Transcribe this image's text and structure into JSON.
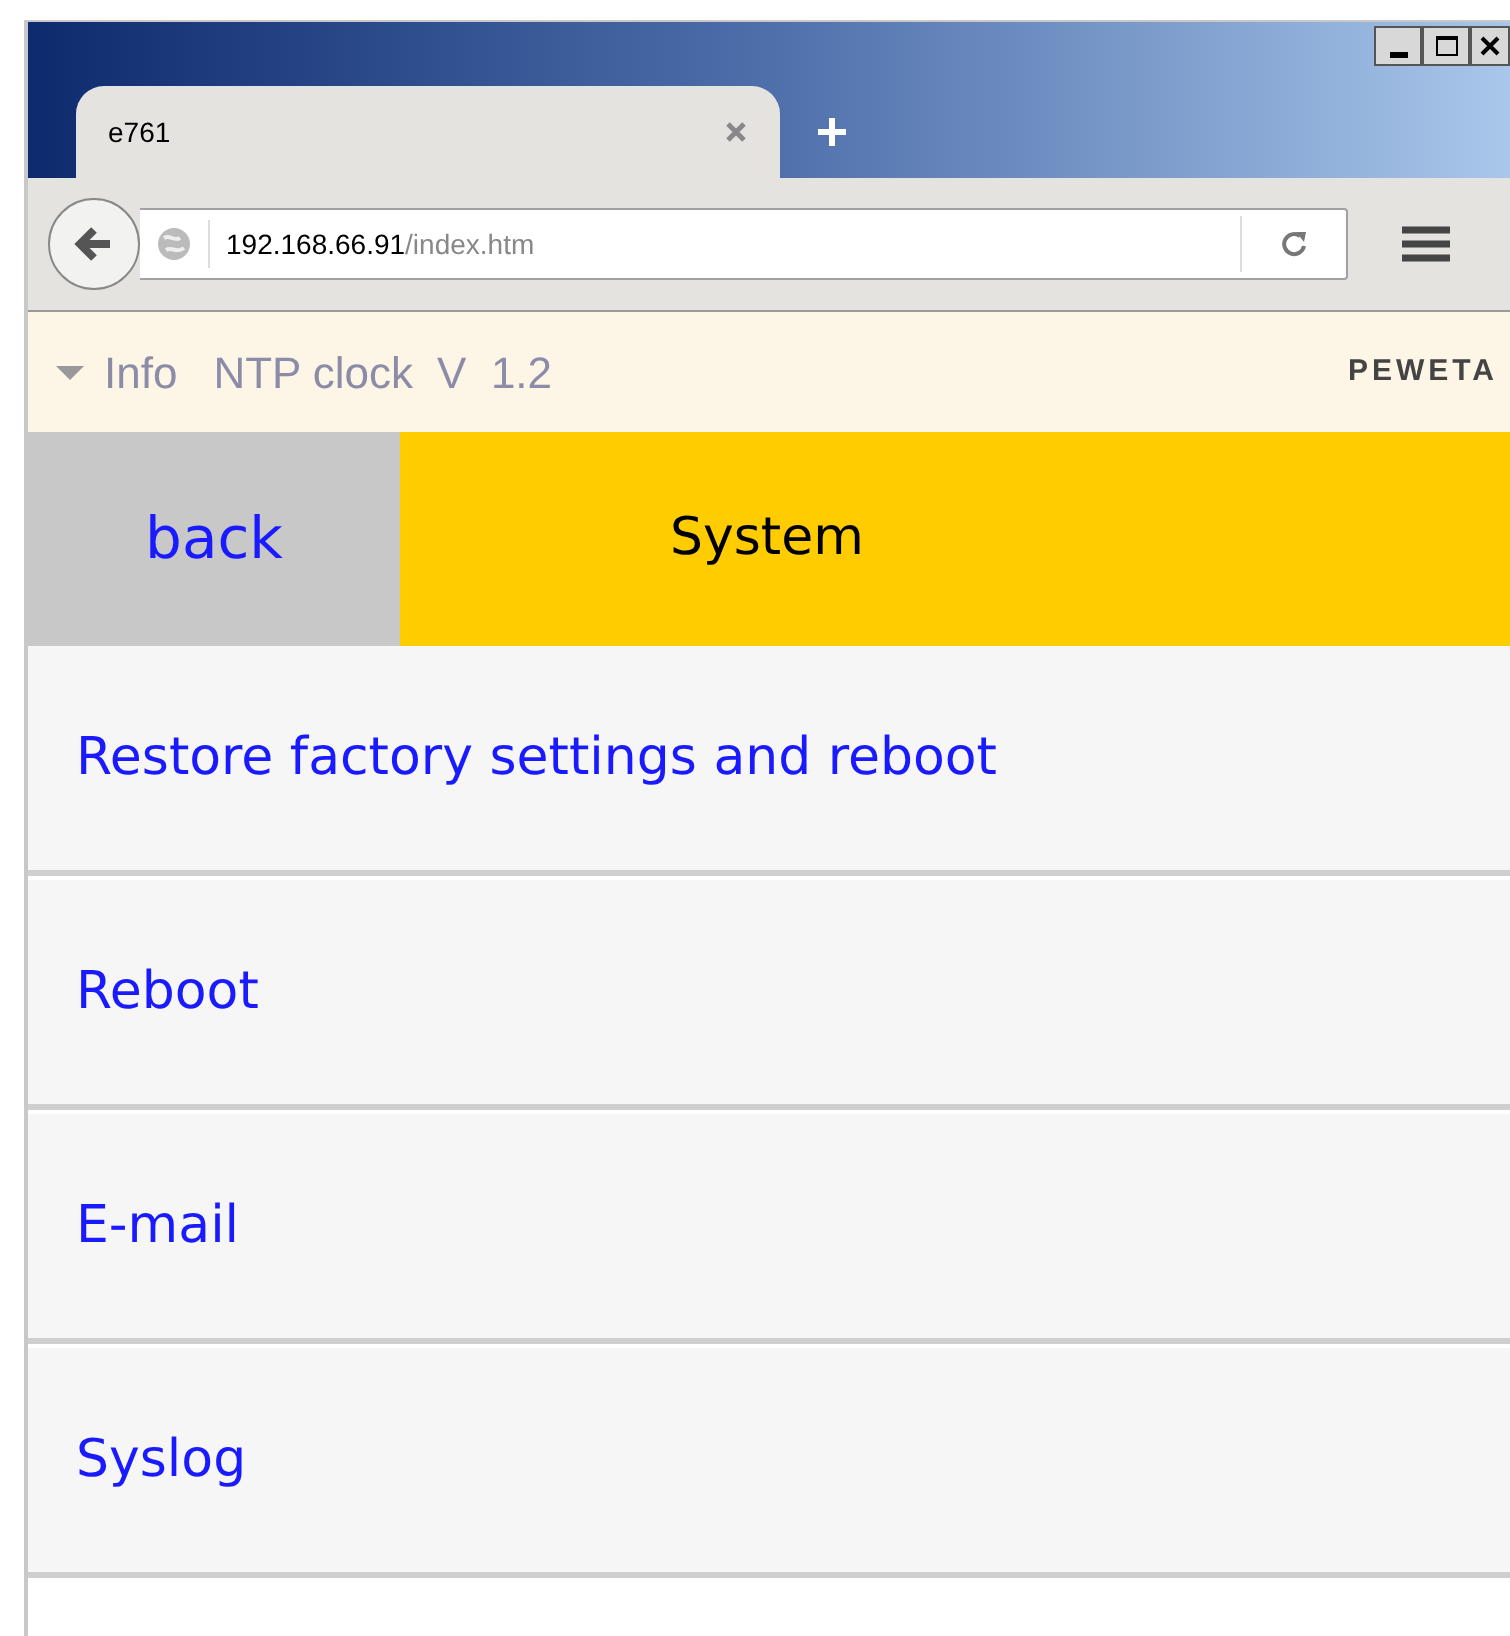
{
  "browser": {
    "tab": {
      "title": "e761"
    },
    "url": {
      "host": "192.168.66.91",
      "path": "/index.htm"
    }
  },
  "info_bar": {
    "expanded": false,
    "label": "Info",
    "title": "NTP clock",
    "version": "V  1.2",
    "logo": "PEWETA"
  },
  "header": {
    "back": "back",
    "title": "System"
  },
  "menu": [
    {
      "label": "Restore factory settings and reboot"
    },
    {
      "label": "Reboot"
    },
    {
      "label": "E-mail"
    },
    {
      "label": "Syslog"
    }
  ]
}
